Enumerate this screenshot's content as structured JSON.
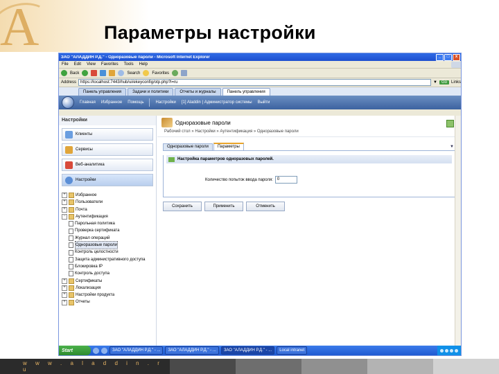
{
  "slide": {
    "title": "Параметры настройки",
    "footer_url": "w w w . a l a d d i n . r u",
    "colors": {
      "brand_orange": "#e7b565",
      "footer_dark": "#2b2b2b",
      "footer_blocks": [
        "#4a4a4a",
        "#6e6e6e",
        "#909090",
        "#b3b3b3",
        "#d2d2d2"
      ]
    }
  },
  "window": {
    "title": "ЗАО \"АЛАДДИН Р.Д.\" - Одноразовые пароли - Microsoft Internet Explorer",
    "controls": [
      "_",
      "□",
      "x"
    ]
  },
  "menubar": {
    "items": [
      "File",
      "Edit",
      "View",
      "Favorites",
      "Tools",
      "Help"
    ]
  },
  "toolbar": {
    "back": "Back",
    "search": "Search",
    "favorites": "Favorites"
  },
  "addressbar": {
    "label": "Address",
    "url": "https://localhost:7443/hub/ui/ekeyconfig/otp.php?l=ru",
    "go": "Go",
    "links": "Links"
  },
  "browser_tabs": [
    {
      "label": "Панель управления",
      "active": false
    },
    {
      "label": "Задачи и политики",
      "active": false
    },
    {
      "label": "Отчеты и журналы",
      "active": false
    },
    {
      "label": "Панель управления",
      "active": true
    }
  ],
  "app_header": {
    "items": [
      "Главная",
      "Избранное",
      "Помощь",
      "Настройки",
      "[1] Aladdin | Администратор системы",
      "Выйти"
    ]
  },
  "left_panel": {
    "heading": "Настройки",
    "nav": [
      {
        "label": "Клиенты",
        "icon": "person-icon",
        "active": false
      },
      {
        "label": "Сервисы",
        "icon": "services-icon",
        "active": false
      },
      {
        "label": "Веб-аналитика",
        "icon": "chart-icon",
        "active": false
      },
      {
        "label": "Настройки",
        "icon": "settings-icon",
        "active": true
      }
    ],
    "tree": [
      {
        "label": "Избранное",
        "level": 0,
        "expander": "+"
      },
      {
        "label": "Пользователи",
        "level": 0,
        "expander": "+"
      },
      {
        "label": "Почта",
        "level": 0,
        "expander": "+"
      },
      {
        "label": "Аутентификация",
        "level": 0,
        "expander": "−"
      },
      {
        "label": "Парольная политика",
        "level": 1
      },
      {
        "label": "Проверка сертификата",
        "level": 1
      },
      {
        "label": "Журнал операций",
        "level": 1
      },
      {
        "label": "Одноразовые пароли",
        "level": 1,
        "selected": true
      },
      {
        "label": "Контроль целостности",
        "level": 1
      },
      {
        "label": "Защита административного доступа",
        "level": 1
      },
      {
        "label": "Блокировка IP",
        "level": 1
      },
      {
        "label": "Контроль доступа",
        "level": 1
      },
      {
        "label": "Сертификаты",
        "level": 0,
        "expander": "+"
      },
      {
        "label": "Локализация",
        "level": 0,
        "expander": "+"
      },
      {
        "label": "Настройки продукта",
        "level": 0,
        "expander": "+"
      },
      {
        "label": "Отчеты",
        "level": 0,
        "expander": "+"
      }
    ]
  },
  "content": {
    "heading": "Одноразовые пароли",
    "breadcrumb": "Рабочий стол » Настройки » Аутентификация » Одноразовые пароли",
    "tabs": [
      {
        "label": "Одноразовые пароли",
        "active": false
      },
      {
        "label": "Параметры",
        "active": true
      }
    ],
    "panel_title": "Настройка параметров одноразовых паролей.",
    "field": {
      "label": "Количество попыток ввода пароля:",
      "value": "0"
    },
    "buttons": [
      "Сохранить",
      "Применить",
      "Отменить"
    ]
  },
  "taskbar": {
    "start": "Start",
    "tasks": [
      {
        "label": "ЗАО \"АЛАДДИН Р.Д.\" - ...",
        "active": false
      },
      {
        "label": "ЗАО \"АЛАДДИН Р.Д.\" - ...",
        "active": false
      },
      {
        "label": "ЗАО \"АЛАДДИН Р.Д.\" - ...",
        "active": true
      },
      {
        "label": "Local intranet",
        "active": false
      }
    ]
  }
}
